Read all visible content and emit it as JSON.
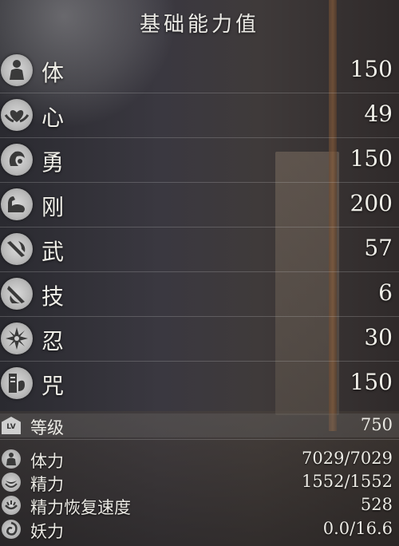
{
  "title": "基础能力值",
  "attributes": [
    {
      "label": "体",
      "value": "150",
      "icon": "body-icon"
    },
    {
      "label": "心",
      "value": "49",
      "icon": "heart-hands-icon"
    },
    {
      "label": "勇",
      "value": "150",
      "icon": "courage-icon"
    },
    {
      "label": "刚",
      "value": "200",
      "icon": "strength-arm-icon"
    },
    {
      "label": "武",
      "value": "57",
      "icon": "martial-icon"
    },
    {
      "label": "技",
      "value": "6",
      "icon": "skill-icon"
    },
    {
      "label": "忍",
      "value": "30",
      "icon": "shuriken-icon"
    },
    {
      "label": "咒",
      "value": "150",
      "icon": "talisman-icon"
    }
  ],
  "level": {
    "label": "等级",
    "value": "750",
    "icon_text": "LV"
  },
  "stats": [
    {
      "label": "体力",
      "value": "7029/7029",
      "icon": "health-icon"
    },
    {
      "label": "精力",
      "value": "1552/1552",
      "icon": "ki-icon"
    },
    {
      "label": "精力恢复速度",
      "value": "528",
      "icon": "ki-recovery-icon"
    },
    {
      "label": "妖力",
      "value": "0.0/16.6",
      "icon": "amrita-spirit-icon"
    }
  ]
}
